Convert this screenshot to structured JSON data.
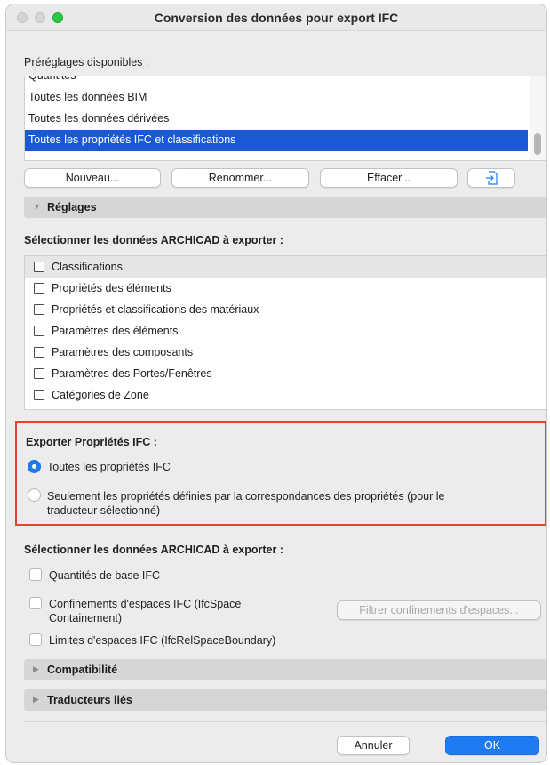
{
  "window": {
    "title": "Conversion des données pour export IFC"
  },
  "presets": {
    "label": "Préréglages disponibles :",
    "items": [
      "Quantités",
      "Toutes les données BIM",
      "Toutes les données dérivées",
      "Toutes les propriétés IFC et classifications"
    ],
    "selected_index": 3
  },
  "preset_buttons": {
    "new": "Nouveau...",
    "rename": "Renommer...",
    "delete": "Effacer...",
    "import_icon": "import-document-icon"
  },
  "settings_section": {
    "title": "Réglages",
    "select_label": "Sélectionner les données ARCHICAD à exporter :",
    "items": [
      {
        "label": "Classifications",
        "checked": false
      },
      {
        "label": "Propriétés des éléments",
        "checked": false
      },
      {
        "label": "Propriétés et classifications des matériaux",
        "checked": false
      },
      {
        "label": "Paramètres des éléments",
        "checked": false
      },
      {
        "label": "Paramètres des composants",
        "checked": false
      },
      {
        "label": "Paramètres des Portes/Fenêtres",
        "checked": false
      },
      {
        "label": "Catégories de Zone",
        "checked": false
      }
    ]
  },
  "ifc_properties": {
    "title": "Exporter Propriétés IFC :",
    "option_all": "Toutes les propriétés IFC",
    "option_mapped_line1": "Seulement les propriétés définies par la correspondances des propriétés (pour le",
    "option_mapped_line2": "traducteur sélectionné)",
    "selected": "all"
  },
  "export_section": {
    "select_label": "Sélectionner les données ARCHICAD à exporter :",
    "base_quantities": "Quantités de base IFC",
    "containment_line1": "Confinements d'espaces IFC (IfcSpace",
    "containment_line2": "Containement)",
    "filter_button": "Filtrer confinements d'espaces...",
    "boundaries": "Limites d'espaces IFC (IfcRelSpaceBoundary)"
  },
  "collapsed_sections": {
    "compatibility": "Compatibilité",
    "translators": "Traducteurs liés"
  },
  "footer": {
    "cancel": "Annuler",
    "ok": "OK"
  },
  "colors": {
    "accent": "#1f7bf2",
    "selection": "#1958d6",
    "highlight_border": "#e8412c"
  }
}
